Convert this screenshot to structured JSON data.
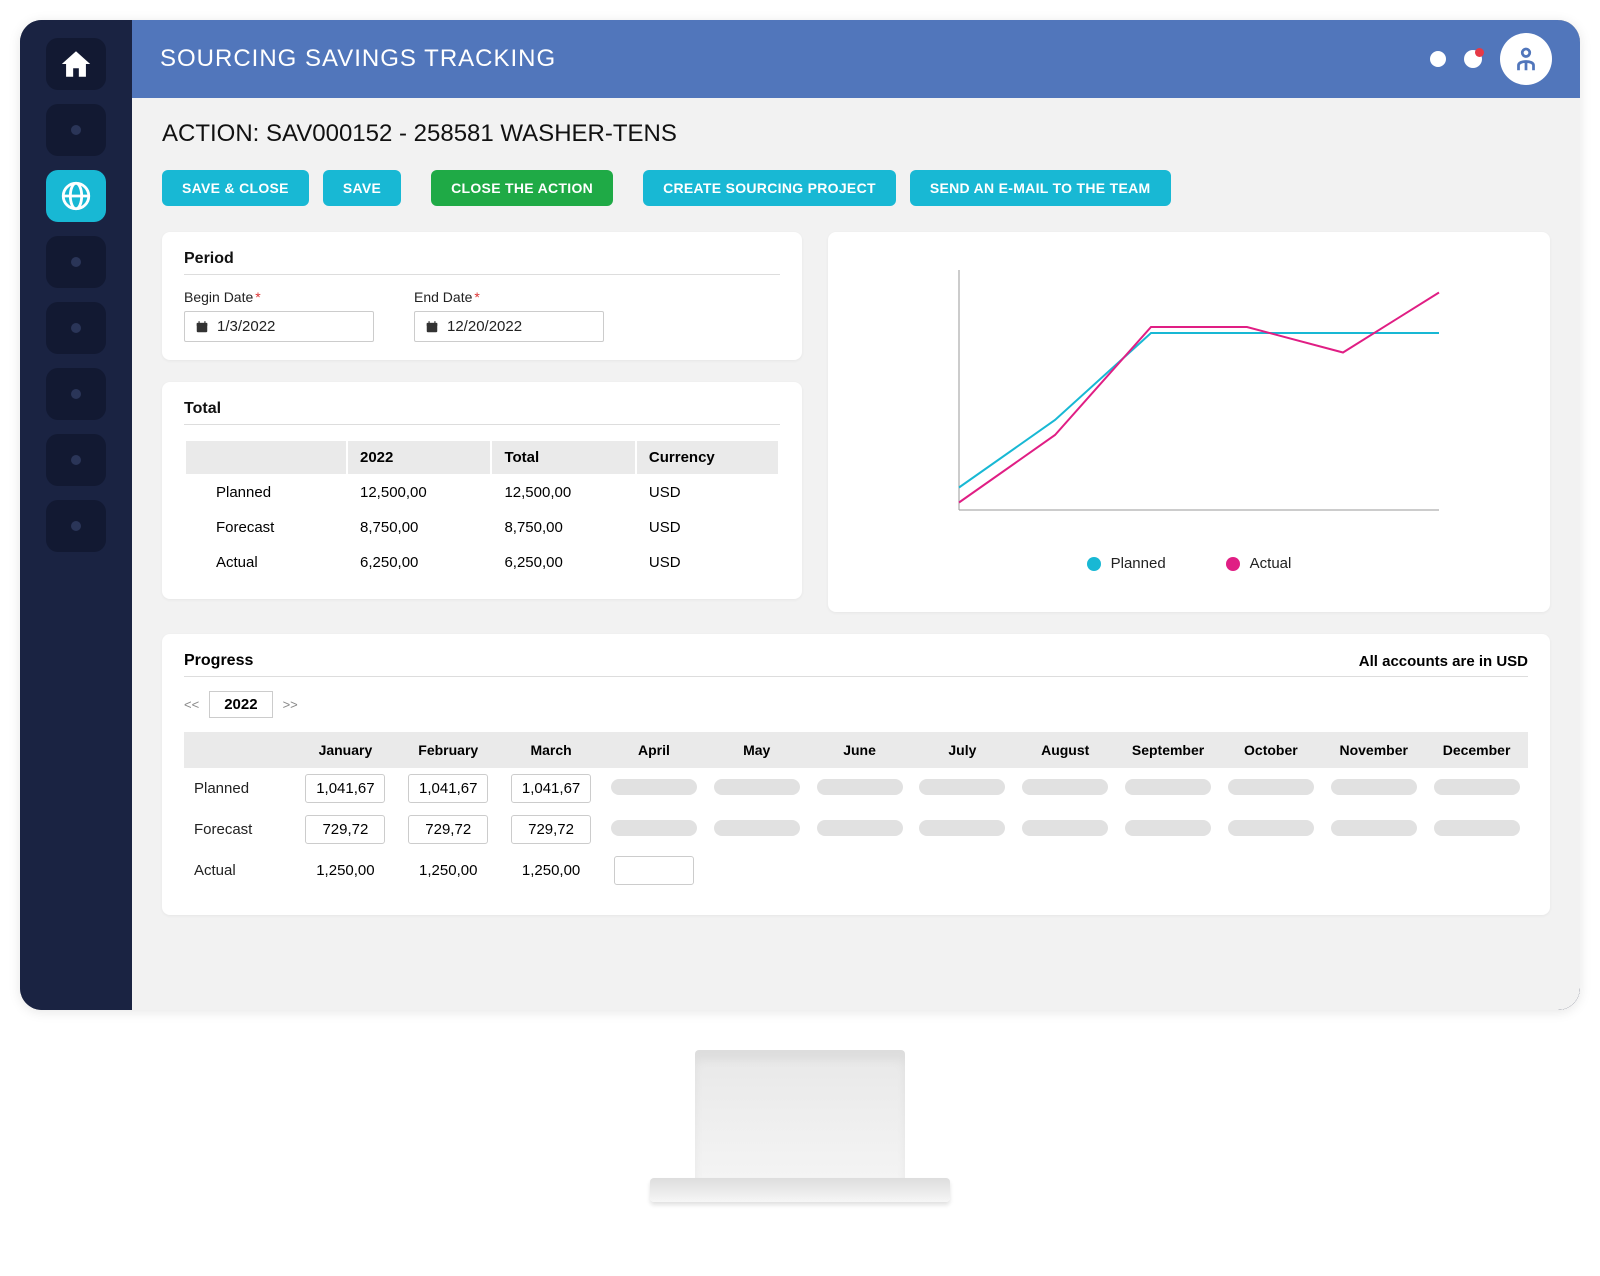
{
  "header": {
    "title": "SOURCING SAVINGS TRACKING"
  },
  "page": {
    "heading": "ACTION: SAV000152 - 258581 WASHER-TENS"
  },
  "buttons": {
    "save_close": "SAVE & CLOSE",
    "save": "SAVE",
    "close_action": "CLOSE THE ACTION",
    "create_project": "CREATE SOURCING PROJECT",
    "send_email": "SEND AN E-MAIL TO THE TEAM"
  },
  "period": {
    "title": "Period",
    "begin_label": "Begin Date",
    "end_label": "End Date",
    "begin_value": "1/3/2022",
    "end_value": "12/20/2022"
  },
  "total": {
    "title": "Total",
    "headers": {
      "year": "2022",
      "total": "Total",
      "currency": "Currency"
    },
    "rows": [
      {
        "label": "Planned",
        "year": "12,500,00",
        "total": "12,500,00",
        "currency": "USD"
      },
      {
        "label": "Forecast",
        "year": "8,750,00",
        "total": "8,750,00",
        "currency": "USD"
      },
      {
        "label": "Actual",
        "year": "6,250,00",
        "total": "6,250,00",
        "currency": "USD"
      }
    ]
  },
  "chart_legend": {
    "planned": "Planned",
    "actual": "Actual"
  },
  "chart_data": {
    "type": "line",
    "title": "",
    "xlabel": "",
    "ylabel": "",
    "x": [
      0,
      1,
      2,
      3,
      4,
      5
    ],
    "series": [
      {
        "name": "Planned",
        "color": "#18b8d4",
        "values": [
          15,
          60,
          118,
          118,
          118,
          118
        ]
      },
      {
        "name": "Actual",
        "color": "#e01e84",
        "values": [
          5,
          50,
          122,
          122,
          105,
          145
        ]
      }
    ],
    "ylim": [
      0,
      160
    ]
  },
  "progress": {
    "title": "Progress",
    "note": "All accounts are in USD",
    "year": "2022",
    "prev": "<<",
    "next": ">>",
    "months": [
      "January",
      "February",
      "March",
      "April",
      "May",
      "June",
      "July",
      "August",
      "September",
      "October",
      "November",
      "December"
    ],
    "rows": [
      {
        "label": "Planned",
        "values": [
          "1,041,67",
          "1,041,67",
          "1,041,67",
          "",
          "",
          "",
          "",
          "",
          "",
          "",
          "",
          ""
        ],
        "boxed": [
          true,
          true,
          true,
          false,
          false,
          false,
          false,
          false,
          false,
          false,
          false,
          false
        ],
        "placeholder_from": 3
      },
      {
        "label": "Forecast",
        "values": [
          "729,72",
          "729,72",
          "729,72",
          "",
          "",
          "",
          "",
          "",
          "",
          "",
          "",
          ""
        ],
        "boxed": [
          true,
          true,
          true,
          false,
          false,
          false,
          false,
          false,
          false,
          false,
          false,
          false
        ],
        "placeholder_from": 3
      },
      {
        "label": "Actual",
        "values": [
          "1,250,00",
          "1,250,00",
          "1,250,00",
          "",
          "",
          "",
          "",
          "",
          "",
          "",
          "",
          ""
        ],
        "boxed": [
          false,
          false,
          false,
          true,
          false,
          false,
          false,
          false,
          false,
          false,
          false,
          false
        ],
        "placeholder_from": 12
      }
    ]
  }
}
